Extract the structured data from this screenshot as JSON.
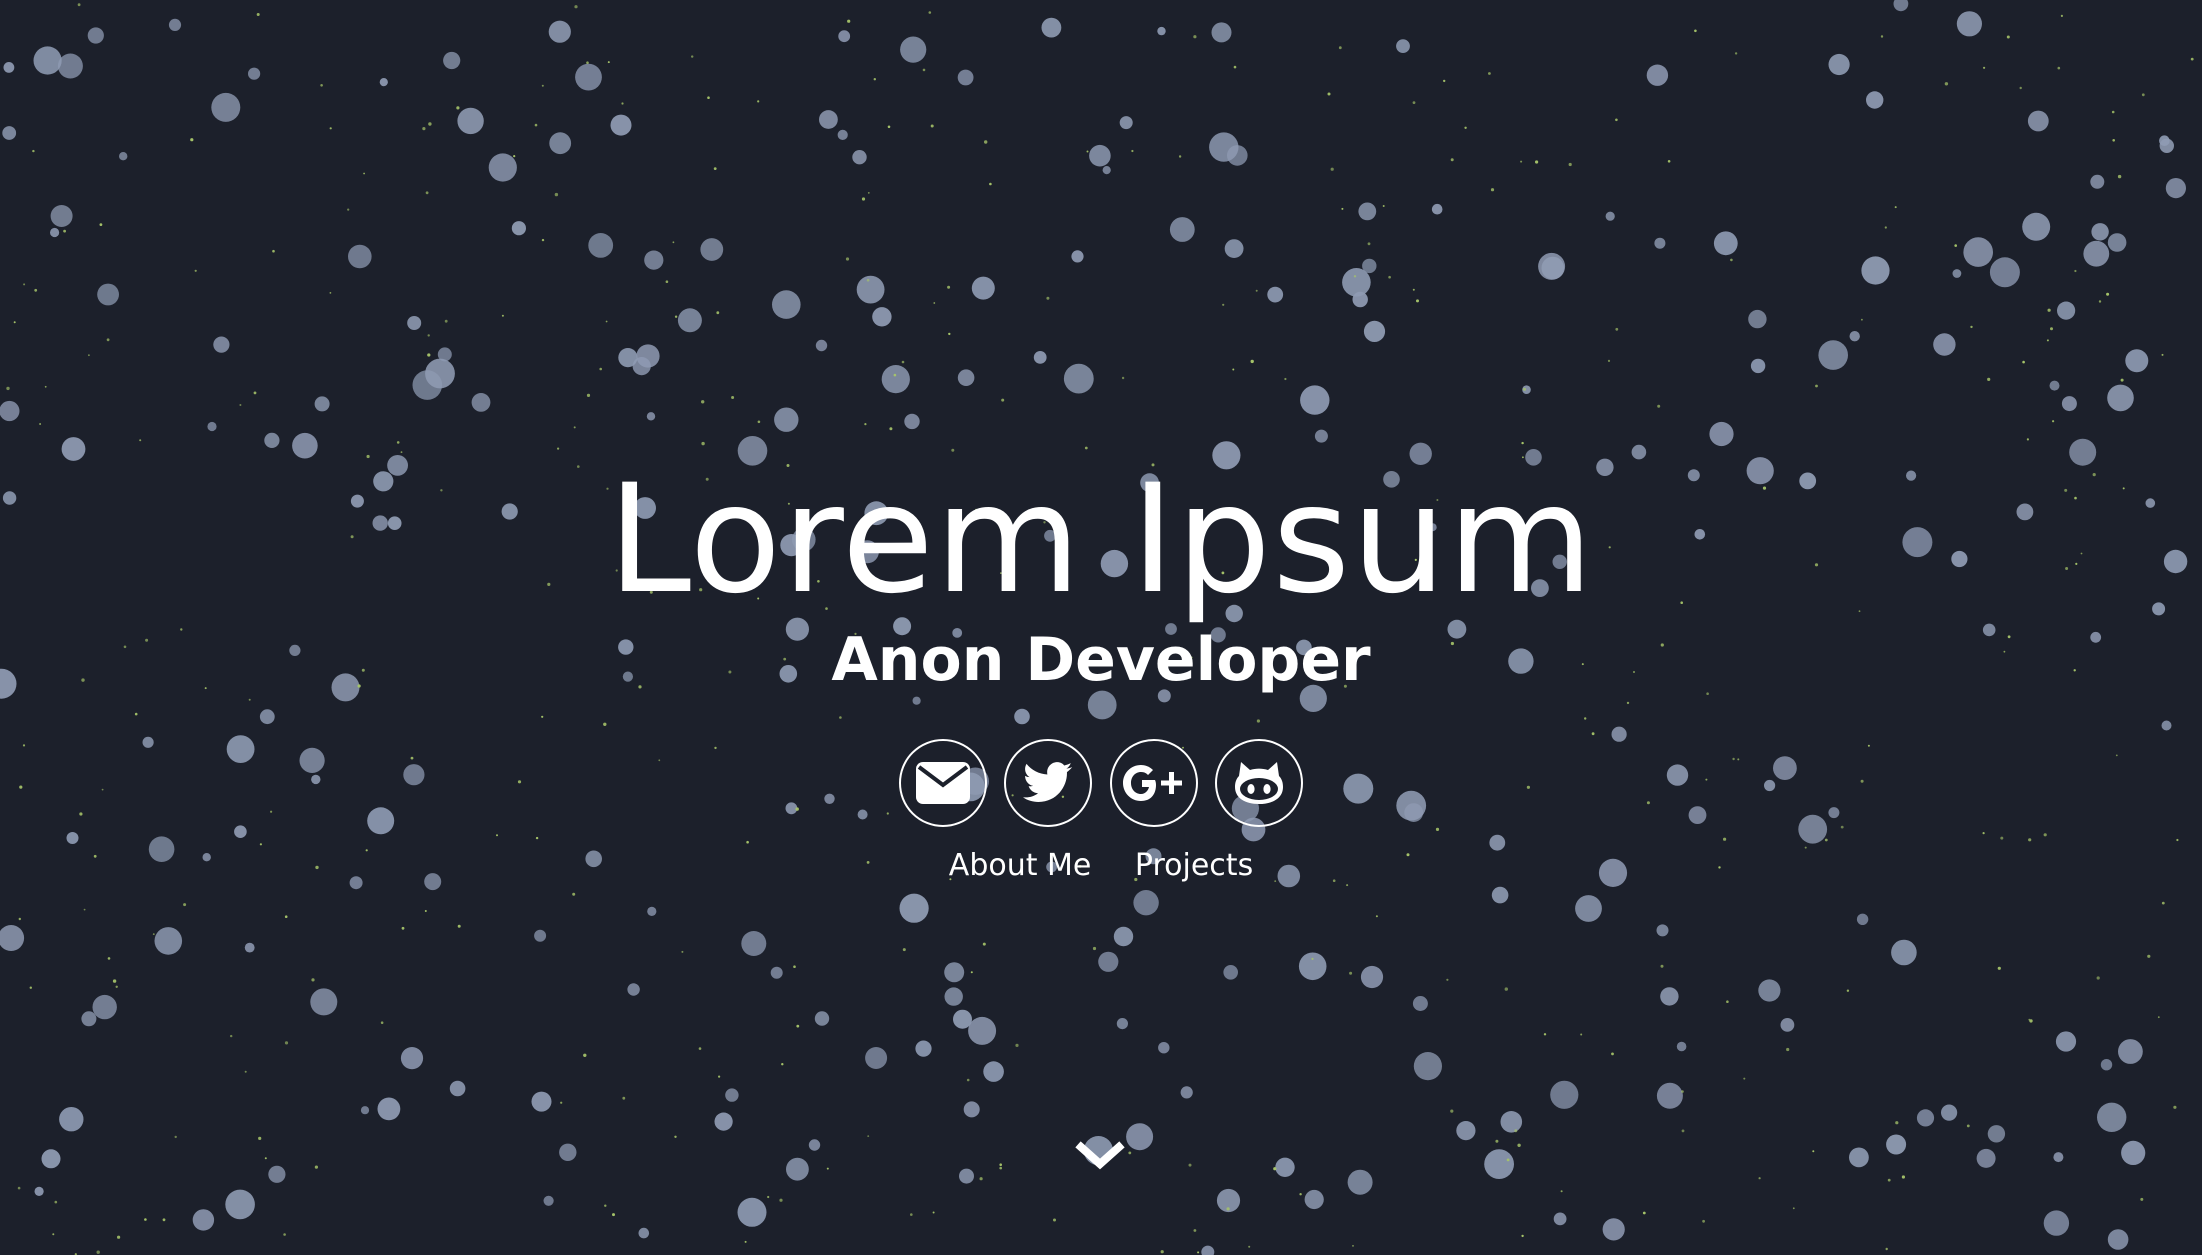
{
  "hero": {
    "title": "Lorem Ipsum",
    "subtitle": "Anon Developer"
  },
  "social": [
    {
      "name": "email",
      "icon": "envelope-icon"
    },
    {
      "name": "twitter",
      "icon": "twitter-bird-icon"
    },
    {
      "name": "google-plus",
      "icon": "google-plus-icon"
    },
    {
      "name": "github",
      "icon": "github-octocat-icon"
    }
  ],
  "nav": {
    "about_label": "About Me",
    "projects_label": "Projects"
  },
  "scroll": {
    "icon": "chevron-down-icon"
  },
  "colors": {
    "background": "#1c202b",
    "particle": "#8f9bb3",
    "star": "#a6c46a",
    "text": "#ffffff"
  }
}
